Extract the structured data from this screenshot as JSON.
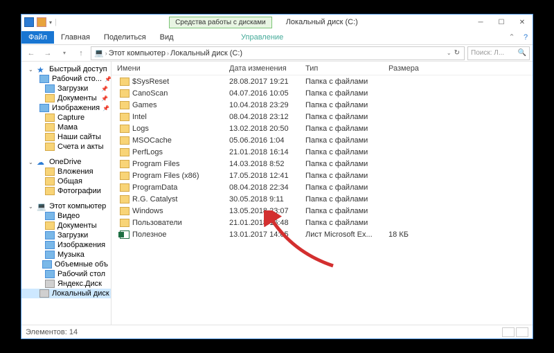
{
  "title": "Локальный диск (C:)",
  "ribbon_context": "Средства работы с дисками",
  "ribbon_context_tab": "Управление",
  "tabs": {
    "file": "Файл",
    "home": "Главная",
    "share": "Поделиться",
    "view": "Вид"
  },
  "breadcrumbs": [
    {
      "icon": "pc",
      "label": "Этот компьютер"
    },
    {
      "icon": "disk",
      "label": "Локальный диск (C:)"
    }
  ],
  "search_placeholder": "Поиск: Л...",
  "columns": {
    "name": "Имени",
    "date": "Дата изменения",
    "type": "Тип",
    "size": "Размера"
  },
  "sidebar": [
    {
      "kind": "group",
      "icon": "star",
      "label": "Быстрый доступ",
      "expanded": true
    },
    {
      "kind": "item",
      "icon": "blue",
      "label": "Рабочий сто...",
      "pinned": true
    },
    {
      "kind": "item",
      "icon": "blue",
      "label": "Загрузки",
      "pinned": true
    },
    {
      "kind": "item",
      "icon": "folder",
      "label": "Документы",
      "pinned": true
    },
    {
      "kind": "item",
      "icon": "blue",
      "label": "Изображения",
      "pinned": true
    },
    {
      "kind": "item",
      "icon": "folder",
      "label": "Capture"
    },
    {
      "kind": "item",
      "icon": "folder",
      "label": "Мама"
    },
    {
      "kind": "item",
      "icon": "folder",
      "label": "Наши сайты"
    },
    {
      "kind": "item",
      "icon": "folder",
      "label": "Счета и акты"
    },
    {
      "kind": "sep"
    },
    {
      "kind": "group",
      "icon": "cloud",
      "label": "OneDrive",
      "expanded": true
    },
    {
      "kind": "item",
      "icon": "folder",
      "label": "Вложения"
    },
    {
      "kind": "item",
      "icon": "folder",
      "label": "Общая"
    },
    {
      "kind": "item",
      "icon": "folder",
      "label": "Фотографии"
    },
    {
      "kind": "sep"
    },
    {
      "kind": "group",
      "icon": "pc",
      "label": "Этот компьютер",
      "expanded": true
    },
    {
      "kind": "item",
      "icon": "blue",
      "label": "Видео"
    },
    {
      "kind": "item",
      "icon": "folder",
      "label": "Документы"
    },
    {
      "kind": "item",
      "icon": "blue",
      "label": "Загрузки"
    },
    {
      "kind": "item",
      "icon": "blue",
      "label": "Изображения"
    },
    {
      "kind": "item",
      "icon": "blue",
      "label": "Музыка"
    },
    {
      "kind": "item",
      "icon": "blue",
      "label": "Объемные объ"
    },
    {
      "kind": "item",
      "icon": "blue",
      "label": "Рабочий стол"
    },
    {
      "kind": "item",
      "icon": "disk",
      "label": "Яндекс.Диск"
    },
    {
      "kind": "item",
      "icon": "disk",
      "label": "Локальный диск",
      "selected": true
    }
  ],
  "files": [
    {
      "name": "$SysReset",
      "date": "28.08.2017 19:21",
      "type": "Папка с файлами",
      "size": ""
    },
    {
      "name": "CanoScan",
      "date": "04.07.2016 10:05",
      "type": "Папка с файлами",
      "size": ""
    },
    {
      "name": "Games",
      "date": "10.04.2018 23:29",
      "type": "Папка с файлами",
      "size": ""
    },
    {
      "name": "Intel",
      "date": "08.04.2018 23:12",
      "type": "Папка с файлами",
      "size": ""
    },
    {
      "name": "Logs",
      "date": "13.02.2018 20:50",
      "type": "Папка с файлами",
      "size": ""
    },
    {
      "name": "MSOCache",
      "date": "05.06.2016 1:04",
      "type": "Папка с файлами",
      "size": ""
    },
    {
      "name": "PerfLogs",
      "date": "21.01.2018 16:14",
      "type": "Папка с файлами",
      "size": ""
    },
    {
      "name": "Program Files",
      "date": "14.03.2018 8:52",
      "type": "Папка с файлами",
      "size": ""
    },
    {
      "name": "Program Files (x86)",
      "date": "17.05.2018 12:41",
      "type": "Папка с файлами",
      "size": ""
    },
    {
      "name": "ProgramData",
      "date": "08.04.2018 22:34",
      "type": "Папка с файлами",
      "size": ""
    },
    {
      "name": "R.G. Catalyst",
      "date": "30.05.2018 9:11",
      "type": "Папка с файлами",
      "size": ""
    },
    {
      "name": "Windows",
      "date": "13.05.2018 23:07",
      "type": "Папка с файлами",
      "size": ""
    },
    {
      "name": "Пользователи",
      "date": "21.01.2018 16:48",
      "type": "Папка с файлами",
      "size": ""
    },
    {
      "name": "Полезное",
      "date": "13.01.2017 14:05",
      "type": "Лист Microsoft Ex...",
      "size": "18 КБ",
      "icon": "xls"
    }
  ],
  "status": {
    "count_label": "Элементов: 14"
  }
}
